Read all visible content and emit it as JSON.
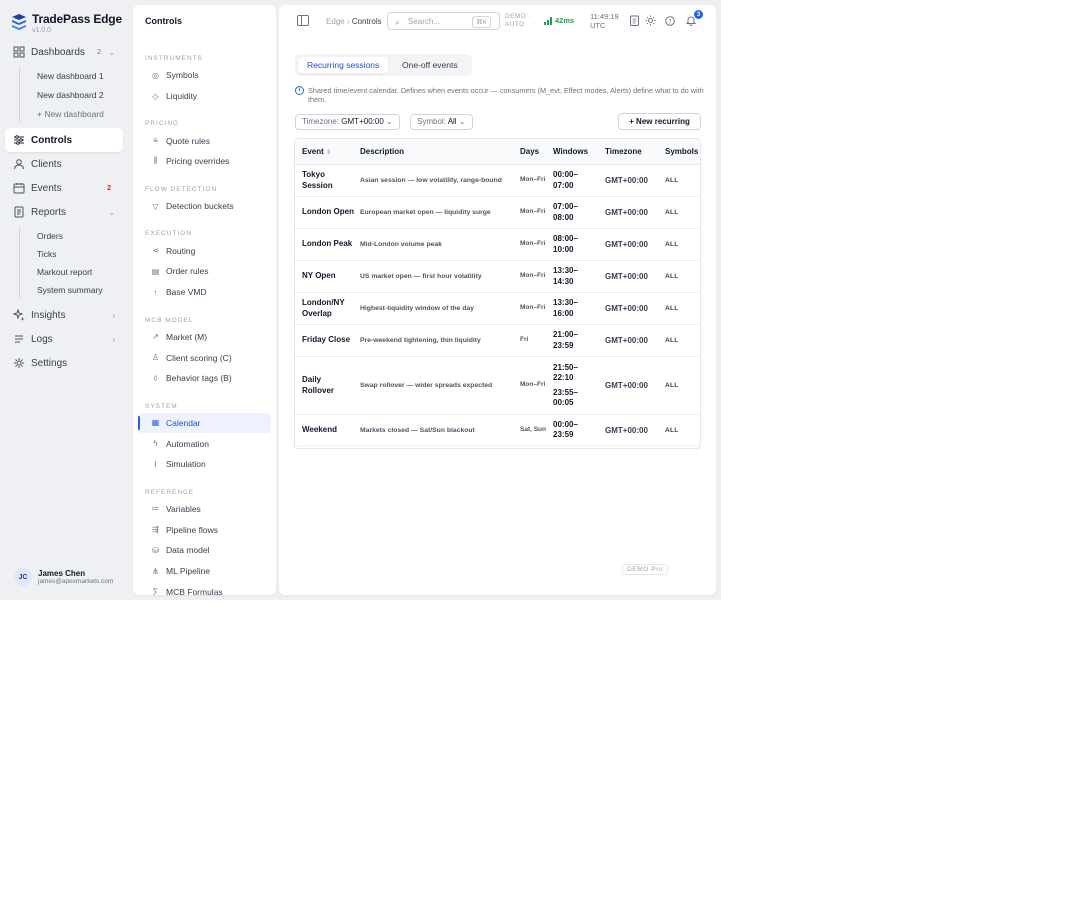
{
  "brand": {
    "name": "TradePass Edge",
    "version": "v1.0.0"
  },
  "nav": {
    "dashboards": {
      "label": "Dashboards",
      "badge": "2",
      "items": [
        "New dashboard 1",
        "New dashboard 2"
      ],
      "add_label": "+ New dashboard"
    },
    "controls": {
      "label": "Controls"
    },
    "clients": {
      "label": "Clients"
    },
    "events": {
      "label": "Events",
      "badge": "2"
    },
    "reports": {
      "label": "Reports",
      "items": [
        "Orders",
        "Ticks",
        "Markout report",
        "System summary"
      ]
    },
    "insights": {
      "label": "Insights"
    },
    "logs": {
      "label": "Logs"
    },
    "settings": {
      "label": "Settings"
    }
  },
  "user": {
    "initials": "JC",
    "name": "James Chen",
    "email": "james@apexmarkets.com"
  },
  "controls_panel": {
    "title": "Controls",
    "sections": [
      {
        "label": "INSTRUMENTS",
        "items": [
          {
            "label": "Symbols",
            "icon": "coin-icon"
          },
          {
            "label": "Liquidity",
            "icon": "droplet-icon"
          }
        ]
      },
      {
        "label": "PRICING",
        "items": [
          {
            "label": "Quote rules",
            "icon": "list-icon"
          },
          {
            "label": "Pricing overrides",
            "icon": "sliders-icon"
          }
        ]
      },
      {
        "label": "FLOW DETECTION",
        "items": [
          {
            "label": "Detection buckets",
            "icon": "filter-icon"
          }
        ]
      },
      {
        "label": "EXECUTION",
        "items": [
          {
            "label": "Routing",
            "icon": "routing-icon"
          },
          {
            "label": "Order rules",
            "icon": "document-icon"
          },
          {
            "label": "Base VMD",
            "icon": "arrow-up-icon"
          }
        ]
      },
      {
        "label": "MCB MODEL",
        "items": [
          {
            "label": "Market (M)",
            "icon": "trend-icon"
          },
          {
            "label": "Client scoring (C)",
            "icon": "user-icon"
          },
          {
            "label": "Behavior tags (B)",
            "icon": "tag-icon"
          }
        ]
      },
      {
        "label": "SYSTEM",
        "items": [
          {
            "label": "Calendar",
            "icon": "calendar-icon",
            "active": true
          },
          {
            "label": "Automation",
            "icon": "bolt-icon"
          },
          {
            "label": "Simulation",
            "icon": "chart-line-icon"
          }
        ]
      },
      {
        "label": "REFERENCE",
        "items": [
          {
            "label": "Variables",
            "icon": "variables-icon"
          },
          {
            "label": "Pipeline flows",
            "icon": "flow-icon"
          },
          {
            "label": "Data model",
            "icon": "database-icon"
          },
          {
            "label": "ML Pipeline",
            "icon": "network-icon"
          },
          {
            "label": "MCB Formulas",
            "icon": "formula-icon"
          }
        ]
      }
    ]
  },
  "topbar": {
    "breadcrumb": {
      "root": "Edge",
      "current": "Controls"
    },
    "search_placeholder": "Search...",
    "search_shortcut": "⌘K",
    "demo_line1": "DEMO ·",
    "demo_line2": "AUTO",
    "latency": "42ms",
    "time": "11:49:19",
    "timezone": "UTC",
    "notifications": "3"
  },
  "tabs": {
    "recurring": "Recurring sessions",
    "oneoff": "One-off events"
  },
  "info_text": "Shared time/event calendar. Defines when events occur — consumers (M_evt, Effect modes, Alerts) define what to do with them.",
  "filters": {
    "timezone_label": "Timezone:",
    "timezone_value": "GMT+00:00",
    "symbol_label": "Symbol:",
    "symbol_value": "All"
  },
  "new_button": "+ New recurring",
  "table": {
    "headers": {
      "event": "Event",
      "description": "Description",
      "days": "Days",
      "windows": "Windows",
      "timezone": "Timezone",
      "symbols": "Symbols"
    },
    "rows": [
      {
        "event": "Tokyo Session",
        "description": "Asian session — low volatility, range-bound",
        "days": "Mon–Fri",
        "windows": [
          "00:00–07:00"
        ],
        "timezone": "GMT+00:00",
        "symbols": "ALL"
      },
      {
        "event": "London Open",
        "description": "European market open — liquidity surge",
        "days": "Mon–Fri",
        "windows": [
          "07:00–08:00"
        ],
        "timezone": "GMT+00:00",
        "symbols": "ALL"
      },
      {
        "event": "London Peak",
        "description": "Mid-London volume peak",
        "days": "Mon–Fri",
        "windows": [
          "08:00–10:00"
        ],
        "timezone": "GMT+00:00",
        "symbols": "ALL"
      },
      {
        "event": "NY Open",
        "description": "US market open — first hour volatility",
        "days": "Mon–Fri",
        "windows": [
          "13:30–14:30"
        ],
        "timezone": "GMT+00:00",
        "symbols": "ALL"
      },
      {
        "event": "London/NY Overlap",
        "description": "Highest-liquidity window of the day",
        "days": "Mon–Fri",
        "windows": [
          "13:30–16:00"
        ],
        "timezone": "GMT+00:00",
        "symbols": "ALL"
      },
      {
        "event": "Friday Close",
        "description": "Pre-weekend tightening, thin liquidity",
        "days": "Fri",
        "windows": [
          "21:00–23:59"
        ],
        "timezone": "GMT+00:00",
        "symbols": "ALL"
      },
      {
        "event": "Daily Rollover",
        "description": "Swap rollover — wider spreads expected",
        "days": "Mon–Fri",
        "windows": [
          "21:50–22:10",
          "23:55–00:05"
        ],
        "timezone": "GMT+00:00",
        "symbols": "ALL"
      },
      {
        "event": "Weekend",
        "description": "Markets closed — Sat/Sun blackout",
        "days": "Sat, Sun",
        "windows": [
          "00:00–23:59"
        ],
        "timezone": "GMT+00:00",
        "symbols": "ALL"
      }
    ]
  },
  "footer_badge": "DEMO Pro",
  "colors": {
    "accent": "#2563eb",
    "latency_green": "#16a34a",
    "badge_red": "#dc2626"
  }
}
